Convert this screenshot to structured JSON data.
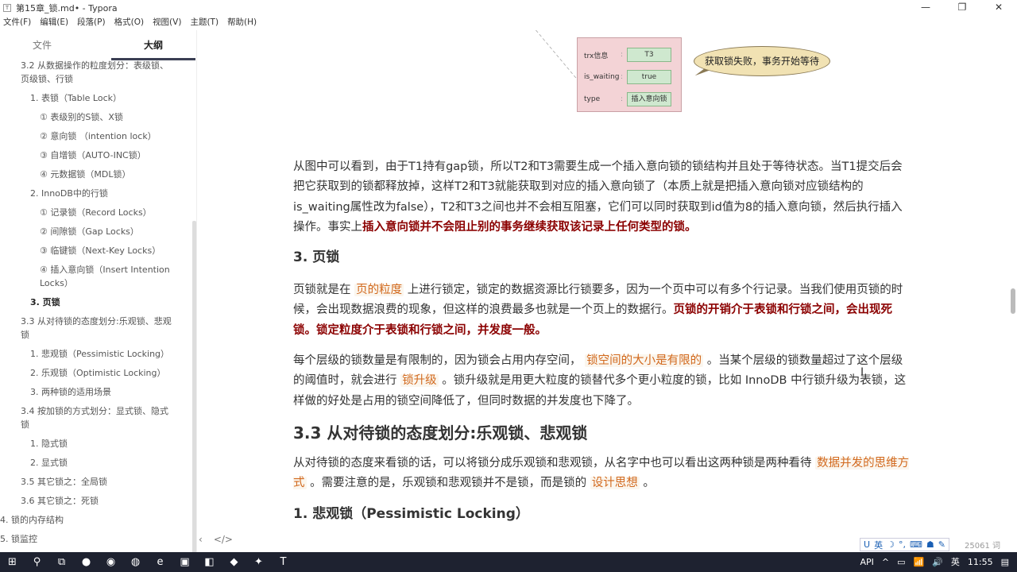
{
  "window": {
    "title": "第15章_锁.md• - Typora",
    "min": "—",
    "max": "❐",
    "close": "✕"
  },
  "menu": [
    "文件(F)",
    "编辑(E)",
    "段落(P)",
    "格式(O)",
    "视图(V)",
    "主题(T)",
    "帮助(H)"
  ],
  "sidebar": {
    "tabs": [
      "文件",
      "大纲"
    ],
    "items": [
      {
        "t": "3.2 从数据操作的粒度划分：表级锁、页级锁、行锁",
        "l": "l1"
      },
      {
        "t": "1. 表锁（Table Lock）",
        "l": "l2"
      },
      {
        "t": "① 表级别的S锁、X锁",
        "l": "l3"
      },
      {
        "t": "② 意向锁 （intention lock）",
        "l": "l3"
      },
      {
        "t": "③ 自增锁（AUTO-INC锁）",
        "l": "l3"
      },
      {
        "t": "④ 元数据锁（MDL锁）",
        "l": "l3"
      },
      {
        "t": "2. InnoDB中的行锁",
        "l": "l2"
      },
      {
        "t": "① 记录锁（Record Locks）",
        "l": "l3"
      },
      {
        "t": "② 间隙锁（Gap Locks）",
        "l": "l3"
      },
      {
        "t": "③ 临键锁（Next-Key Locks）",
        "l": "l3"
      },
      {
        "t": "④ 插入意向锁（Insert Intention Locks）",
        "l": "l3"
      },
      {
        "t": "3. 页锁",
        "l": "l2 cur"
      },
      {
        "t": "3.3 从对待锁的态度划分:乐观锁、悲观锁",
        "l": "l1"
      },
      {
        "t": "1. 悲观锁（Pessimistic Locking）",
        "l": "l2"
      },
      {
        "t": "2. 乐观锁（Optimistic Locking）",
        "l": "l2"
      },
      {
        "t": "3. 两种锁的适用场景",
        "l": "l2"
      },
      {
        "t": "3.4 按加锁的方式划分：显式锁、隐式锁",
        "l": "l1"
      },
      {
        "t": "1. 隐式锁",
        "l": "l2"
      },
      {
        "t": "2. 显式锁",
        "l": "l2"
      },
      {
        "t": "3.5 其它锁之：全局锁",
        "l": "l1"
      },
      {
        "t": "3.6 其它锁之：死锁",
        "l": "l1"
      },
      {
        "t": "4. 锁的内存结构",
        "l": "l0"
      },
      {
        "t": "5. 锁监控",
        "l": "l0"
      }
    ],
    "footer": [
      "‹",
      "</>"
    ]
  },
  "diagram": {
    "rows": [
      {
        "k": "trx信息",
        "v": "T3"
      },
      {
        "k": "is_waiting",
        "v": "true"
      },
      {
        "k": "type",
        "v": "插入意向锁"
      }
    ],
    "sep": ":",
    "bubble": "获取锁失败，事务开始等待"
  },
  "doc": [
    {
      "tag": "p",
      "segs": [
        {
          "t": "从图中可以看到，由于T1持有gap锁，所以T2和T3需要生成一个插入意向锁的锁结构并且处于等待状态。当T1提交后会把它获取到的锁都释放掉，这样T2和T3就能获取到对应的插入意向锁了（本质上就是把插入意向锁对应锁结构的is_waiting属性改为false），T2和T3之间也并不会相互阻塞，它们可以同时获取到id值为8的插入意向锁，然后执行插入操作。事实上"
        },
        {
          "t": "插入意向锁并不会阻止别的事务继续获取该记录上任何类型的锁。",
          "s": "strong"
        }
      ]
    },
    {
      "tag": "h3",
      "segs": [
        {
          "t": "3. 页锁"
        }
      ]
    },
    {
      "tag": "p",
      "segs": [
        {
          "t": "页锁就是在 "
        },
        {
          "t": "页的粒度",
          "s": "code"
        },
        {
          "t": " 上进行锁定，锁定的数据资源比行锁要多，因为一个页中可以有多个行记录。当我们使用页锁的时候，会出现数据浪费的现象，但这样的浪费最多也就是一个页上的数据行。"
        },
        {
          "t": "页锁的开销介于表锁和行锁之间，会出现死锁。锁定粒度介于表锁和行锁之间，并发度一般。",
          "s": "strong"
        }
      ]
    },
    {
      "tag": "p",
      "segs": [
        {
          "t": "每个层级的锁数量是有限制的，因为锁会占用内存空间， "
        },
        {
          "t": "锁空间的大小是有限的",
          "s": "code"
        },
        {
          "t": " 。当某个层级的锁数量超过了这个层级的阈值时，就会进行 "
        },
        {
          "t": "锁升级",
          "s": "code"
        },
        {
          "t": " 。锁升级就是用更大粒度的锁替代多个更小粒度的锁，比如 InnoDB 中行锁升级为表锁，这样做的好处是占用的锁空间降低了，但同时数据的并发度也下降了。"
        }
      ]
    },
    {
      "tag": "h2",
      "segs": [
        {
          "t": "3.3 从对待锁的态度划分:乐观锁、悲观锁"
        }
      ]
    },
    {
      "tag": "p",
      "segs": [
        {
          "t": "从对待锁的态度来看锁的话，可以将锁分成乐观锁和悲观锁，从名字中也可以看出这两种锁是两种看待 "
        },
        {
          "t": "数据并发的思维方式",
          "s": "code"
        },
        {
          "t": " 。需要注意的是，乐观锁和悲观锁并不是锁，而是锁的 "
        },
        {
          "t": "设计思想",
          "s": "code"
        },
        {
          "t": " 。"
        }
      ]
    },
    {
      "tag": "h3",
      "segs": [
        {
          "t": "1. 悲观锁（Pessimistic Locking）"
        }
      ]
    }
  ],
  "status": {
    "ime": [
      "U",
      "英",
      "☽",
      "°,",
      "⌨",
      "☗",
      "✎"
    ],
    "word_count": "25061 词"
  },
  "taskbar": {
    "icons": [
      "⊞",
      "⚲",
      "⧉",
      "●",
      "◉",
      "◍",
      "e",
      "▣",
      "◧",
      "◆",
      "✦",
      "T"
    ],
    "tray": [
      "API",
      "^",
      "▭",
      "📶",
      "🔊",
      "英",
      "11:55",
      "▤"
    ]
  }
}
